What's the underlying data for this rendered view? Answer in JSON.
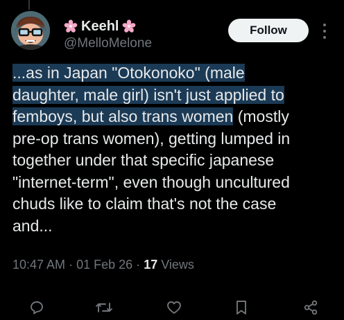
{
  "author": {
    "display_name": "Keehl",
    "handle": "@MelloMelone",
    "name_emoji": "cherry-blossom-icon"
  },
  "follow_button": {
    "label": "Follow"
  },
  "tweet": {
    "lines": [
      "...as in Japan \"Otokonoko\" (male",
      "daughter, male girl) isn't just applied to",
      "femboys, but also trans women",
      " (mostly",
      "pre-op trans women), getting lumped in",
      "together under that specific japanese",
      "\"internet-term\", even though uncultured",
      "chuds like to claim that's not the case",
      "and..."
    ],
    "time": "10:47 AM",
    "separator": "·",
    "date": "01 Feb 26",
    "views_count": "17",
    "views_label": "Views"
  },
  "colors": {
    "background": "#000000",
    "text": "#e7e9ea",
    "secondary": "#71767b",
    "highlight": "#1b3a55",
    "flower": "#f7a8c8"
  },
  "icons": [
    "reply-icon",
    "repost-icon",
    "like-icon",
    "bookmark-icon",
    "share-icon"
  ]
}
